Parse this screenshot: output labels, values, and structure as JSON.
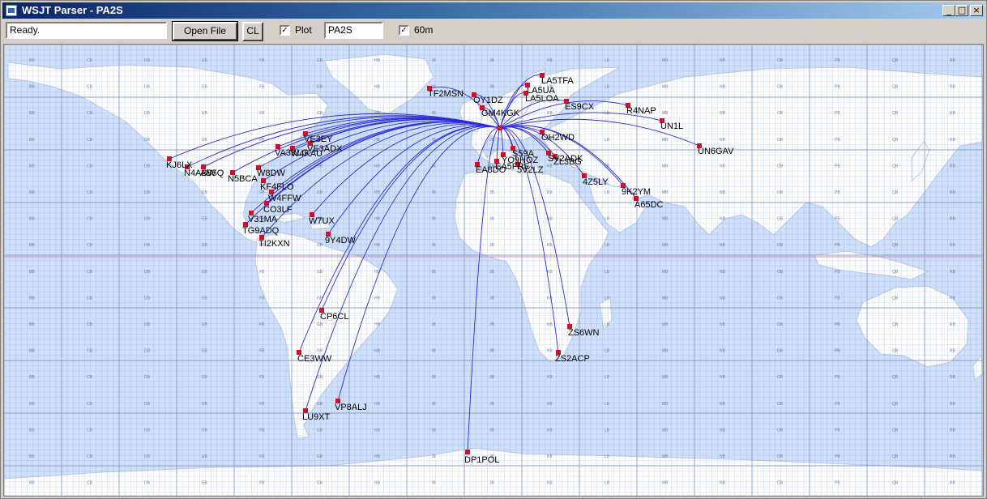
{
  "window": {
    "title": "WSJT Parser - PA2S",
    "controls": [
      "_",
      "□",
      "×"
    ]
  },
  "toolbar": {
    "status": "Ready.",
    "open_label": "Open File",
    "cl_label": "CL",
    "plot_checked": true,
    "plot_label": "Plot",
    "callsign": "PA2S",
    "band_checked": true,
    "band_label": "60m"
  },
  "map": {
    "home": {
      "call": "PA2S"
    },
    "colors": {
      "ocean": "#cfe0fb",
      "land": "#ffffff",
      "grid": "#7d93c4",
      "path": "#2a2ae0",
      "marker": "#d0102a"
    },
    "grid_labels": {
      "columns": [
        "BA",
        "CA",
        "DA",
        "EA",
        "FA",
        "GA",
        "HA",
        "IA",
        "JA",
        "KA",
        "LA",
        "MA",
        "NA",
        "OA",
        "PA",
        "QA",
        "RA"
      ],
      "rows": [
        "BQ",
        "BP",
        "BO",
        "BN",
        "BM",
        "BL",
        "BK",
        "BJ",
        "BI",
        "BH",
        "BG",
        "BF",
        "BE",
        "BD",
        "BC",
        "BB",
        "BA"
      ]
    },
    "stations": [
      {
        "call": "LA5TFA"
      },
      {
        "call": "LA5UA"
      },
      {
        "call": "LA5LOA"
      },
      {
        "call": "TF2MSN"
      },
      {
        "call": "OY1DZ"
      },
      {
        "call": "GM4KGK"
      },
      {
        "call": "R4NAP"
      },
      {
        "call": "UN1L"
      },
      {
        "call": "UN6GAV"
      },
      {
        "call": "ES9CX"
      },
      {
        "call": "KJ6LX"
      },
      {
        "call": "N4ABW"
      },
      {
        "call": "AB5Q"
      },
      {
        "call": "N5BCA"
      },
      {
        "call": "VA3KLG"
      },
      {
        "call": "KF4FLO"
      },
      {
        "call": "W4FFW"
      },
      {
        "call": "CO3LF"
      },
      {
        "call": "V31MA"
      },
      {
        "call": "TG9ADQ"
      },
      {
        "call": "TI2KXN"
      },
      {
        "call": "W7UX"
      },
      {
        "call": "9Y4DW"
      },
      {
        "call": "CP6CL"
      },
      {
        "call": "CE3WW"
      },
      {
        "call": "LU9XT"
      },
      {
        "call": "VP8ALJ"
      },
      {
        "call": "DP1POL"
      },
      {
        "call": "ZS6WN"
      },
      {
        "call": "ZS2ACP"
      },
      {
        "call": "9K2YM"
      },
      {
        "call": "A65DC"
      },
      {
        "call": "4Z5LY"
      },
      {
        "call": "5V2LZ"
      },
      {
        "call": "SV2ADK"
      },
      {
        "call": "EA8DO"
      },
      {
        "call": "EA5FRE"
      },
      {
        "call": "S59A"
      },
      {
        "call": "YO9HOZ"
      },
      {
        "call": "OH2WD"
      },
      {
        "call": "ZL3BG"
      },
      {
        "call": "VE3EY"
      },
      {
        "call": "W4KAU"
      },
      {
        "call": "VE3ADX"
      },
      {
        "call": "W8DW"
      }
    ]
  }
}
